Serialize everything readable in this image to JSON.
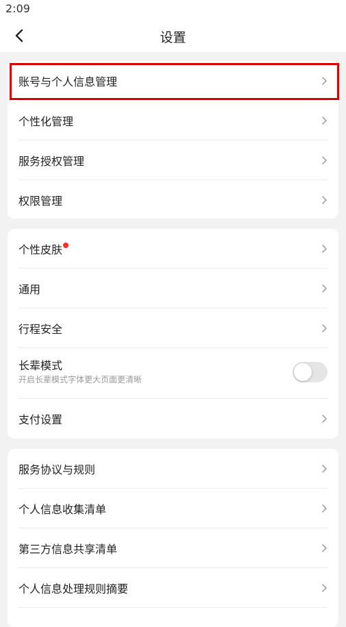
{
  "status_bar": {
    "time": "2:09"
  },
  "header": {
    "title": "设置",
    "back_icon": "chevron-left-icon"
  },
  "groups": {
    "account": [
      {
        "label": "账号与个人信息管理"
      },
      {
        "label": "个性化管理"
      },
      {
        "label": "服务授权管理"
      },
      {
        "label": "权限管理"
      }
    ],
    "general": {
      "skin": {
        "label": "个性皮肤",
        "has_red_dot": true
      },
      "common": {
        "label": "通用"
      },
      "trip_safety": {
        "label": "行程安全"
      },
      "elder_mode": {
        "title": "长辈模式",
        "subtitle": "开启长辈模式字体更大页面更清晰",
        "enabled": false
      },
      "payment": {
        "label": "支付设置"
      }
    },
    "legal": [
      {
        "label": "服务协议与规则"
      },
      {
        "label": "个人信息收集清单"
      },
      {
        "label": "第三方信息共享清单"
      },
      {
        "label": "个人信息处理规则摘要"
      }
    ]
  },
  "colors": {
    "background": "#f2f2f2",
    "card": "#ffffff",
    "highlight": "#d90000",
    "red_dot": "#ff2d2d",
    "toggle_off": "#e5e5e5"
  },
  "icons": {
    "chevron": "chevron-right-icon",
    "back": "chevron-left-icon"
  }
}
